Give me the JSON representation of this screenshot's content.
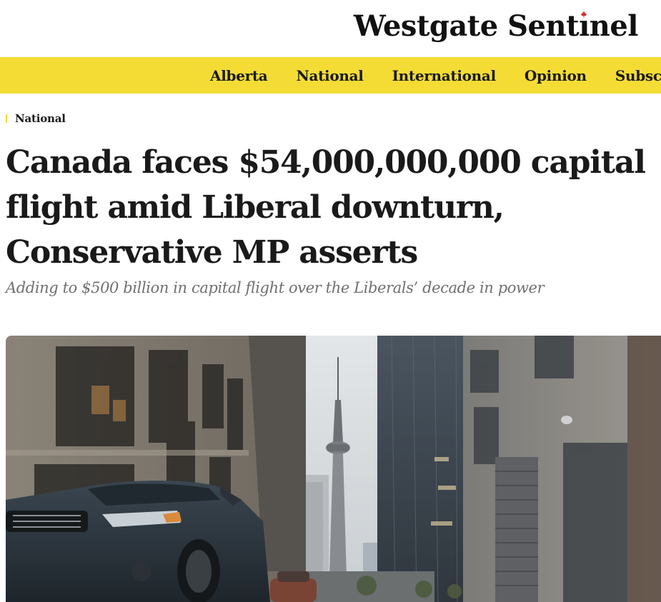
{
  "site": {
    "name_part1": "Westgate Sentinel",
    "name_display": [
      "Westgate Sent",
      "ı",
      "nel"
    ]
  },
  "nav": {
    "items": [
      {
        "label": "Alberta"
      },
      {
        "label": "National"
      },
      {
        "label": "International"
      },
      {
        "label": "Opinion"
      },
      {
        "label": "Subscribe"
      }
    ]
  },
  "article": {
    "section": "National",
    "headline": "Canada faces $54,000,000,000 capital flight amid Liberal downturn, Conservative MP asserts",
    "subheadline": "Adding to $500 billion in capital flight over the Liberals’ decade in power"
  },
  "hero_image": {
    "subject": "Toronto street with CN Tower between office towers and parked cars"
  },
  "colors": {
    "nav_background": "#f5dc35",
    "accent_red": "#d6262b",
    "text": "#1a1a1a",
    "subhead": "#707070"
  },
  "icons": {
    "logo_accent": "maple-leaf-icon"
  }
}
